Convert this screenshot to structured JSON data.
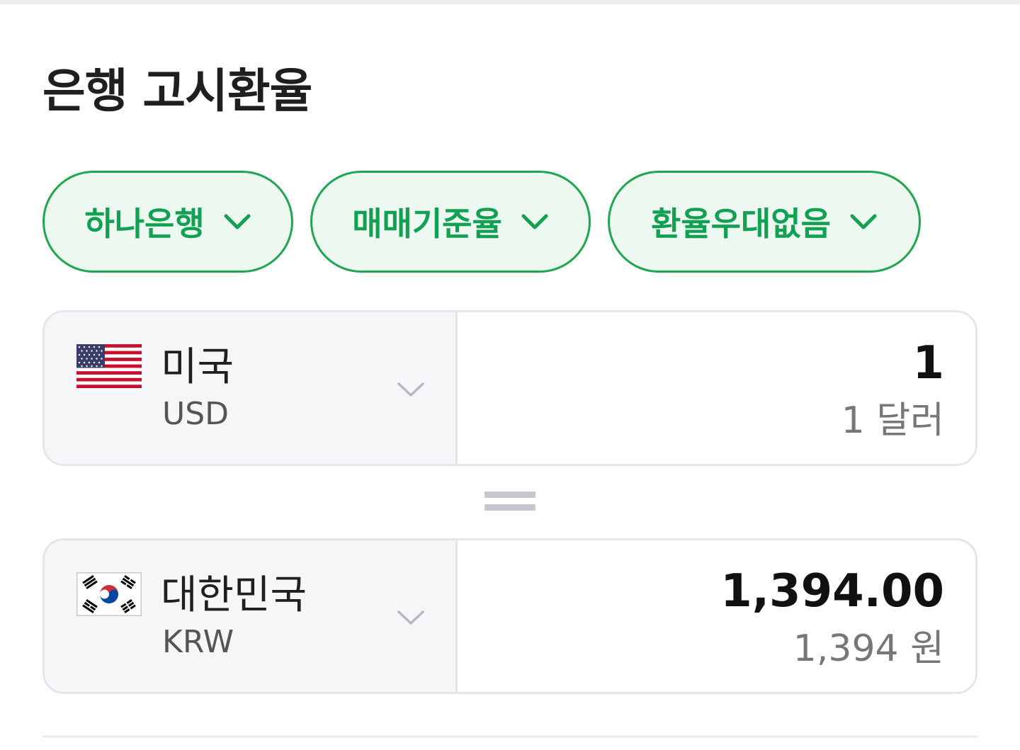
{
  "title": "은행 고시환율",
  "filters": {
    "bank": "하나은행",
    "rate_type": "매매기준율",
    "preferential": "환율우대없음"
  },
  "colors": {
    "accent": "#12a152",
    "chip_border": "#1fa653",
    "chip_bg": "#edf8f1",
    "box_border": "#e6e6ea",
    "select_bg": "#f6f6f8"
  },
  "from": {
    "country": "미국",
    "code": "USD",
    "flag": "us-flag-icon",
    "amount": "1",
    "amount_text": "1 달러"
  },
  "to": {
    "country": "대한민국",
    "code": "KRW",
    "flag": "kr-flag-icon",
    "amount": "1,394.00",
    "amount_text": "1,394 원"
  },
  "equals_icon": "equals-icon",
  "dropdown_icon": "chevron-down-icon"
}
